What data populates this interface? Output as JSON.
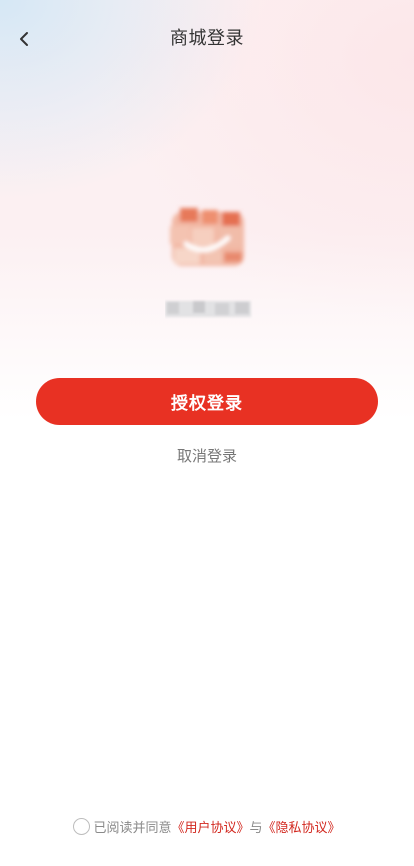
{
  "header": {
    "title": "商城登录",
    "back_icon": "chevron-left-icon"
  },
  "shop": {
    "logo": "blurred-shop-logo",
    "name_hidden": true
  },
  "actions": {
    "authorize_label": "授权登录",
    "cancel_label": "取消登录"
  },
  "agreement": {
    "prefix": "已阅读并同意",
    "user_agreement": "《用户协议》",
    "connector": "与",
    "privacy_policy": "《隐私协议》",
    "checked": false
  },
  "colors": {
    "accent": "#e83123",
    "link": "#d2281f"
  }
}
